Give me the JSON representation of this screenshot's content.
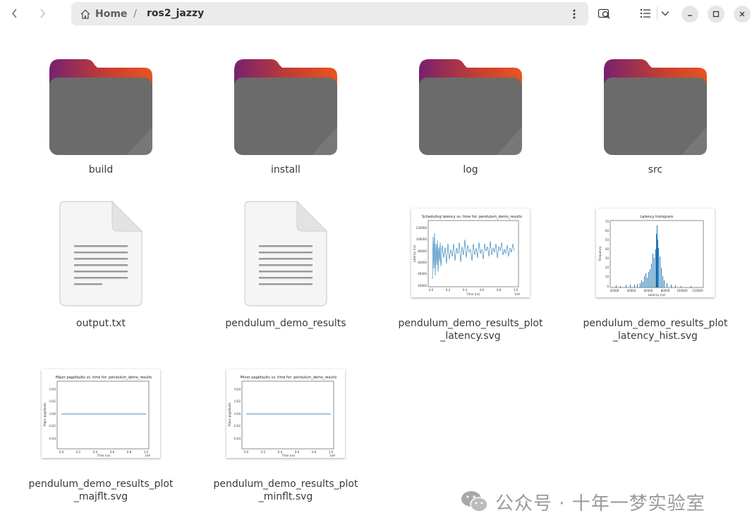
{
  "path": {
    "home_label": "Home",
    "separator": "/",
    "current": "ros2_jazzy"
  },
  "icons": {
    "back": "chevron-left-icon",
    "forward": "chevron-right-icon",
    "home": "home-icon",
    "menu": "kebab-menu-icon",
    "search": "search-icon",
    "view": "list-view-icon",
    "view_options": "chevron-down-icon",
    "minimize": "minimize-icon",
    "maximize": "maximize-icon",
    "close": "close-icon"
  },
  "folders": [
    {
      "name": "build"
    },
    {
      "name": "install"
    },
    {
      "name": "log"
    },
    {
      "name": "src"
    }
  ],
  "files": [
    {
      "name": "output.txt",
      "type": "text"
    },
    {
      "name": "pendulum_demo_results",
      "type": "text"
    },
    {
      "name_line1": "pendulum_demo_results_plot",
      "name_line2": "_latency.svg",
      "type": "svg",
      "thumb": {
        "title": "Scheduling latency vs. time for: pendulum_demo_results",
        "xlabel": "Time (ns)",
        "ylabel": "Latency (ns)",
        "yticks": [
          "120000",
          "100000",
          "80000",
          "60000",
          "40000",
          "20000"
        ],
        "xticks": [
          "0.0",
          "0.2",
          "0.4",
          "0.6",
          "0.8",
          "1.0"
        ],
        "scale": "1e9"
      }
    },
    {
      "name_line1": "pendulum_demo_results_plot",
      "name_line2": "_latency_hist.svg",
      "type": "svg",
      "thumb": {
        "title": "Latency histogram",
        "xlabel": "Latency (ns)",
        "ylabel": "Frequency",
        "yticks": [
          "70",
          "60",
          "50",
          "40",
          "30",
          "20",
          "10",
          "0"
        ],
        "xticks": [
          "20000",
          "40000",
          "60000",
          "80000",
          "100000",
          "120000"
        ]
      }
    },
    {
      "name_line1": "pendulum_demo_results_plot",
      "name_line2": "_majflt.svg",
      "type": "svg",
      "thumb": {
        "title": "Major pagefaults vs. time for: pendulum_demo_results",
        "xlabel": "Time (ns)",
        "ylabel": "Major pagefaults",
        "yticks": [
          "0.04",
          "0.02",
          "0.00",
          "-0.02",
          "-0.04"
        ],
        "xticks": [
          "0.0",
          "0.2",
          "0.4",
          "0.6",
          "0.8",
          "1.0"
        ],
        "scale": "1e9"
      }
    },
    {
      "name_line1": "pendulum_demo_results_plot",
      "name_line2": "_minflt.svg",
      "type": "svg",
      "thumb": {
        "title": "Minor pagefaults vs. time for: pendulum_demo_results",
        "xlabel": "Time (ns)",
        "ylabel": "Minor pagefaults",
        "yticks": [
          "0.04",
          "0.02",
          "0.00",
          "-0.02",
          "-0.04"
        ],
        "xticks": [
          "0.0",
          "0.2",
          "0.4",
          "0.6",
          "0.8",
          "1.0"
        ],
        "scale": "1e9"
      }
    }
  ],
  "watermark": {
    "text": "公众号 · 十年一梦实验室"
  },
  "colors": {
    "folder_top": "#e95420",
    "folder_top2": "#77216f",
    "folder_body": "#6b6b6b",
    "plot_line": "#1f77b4"
  }
}
